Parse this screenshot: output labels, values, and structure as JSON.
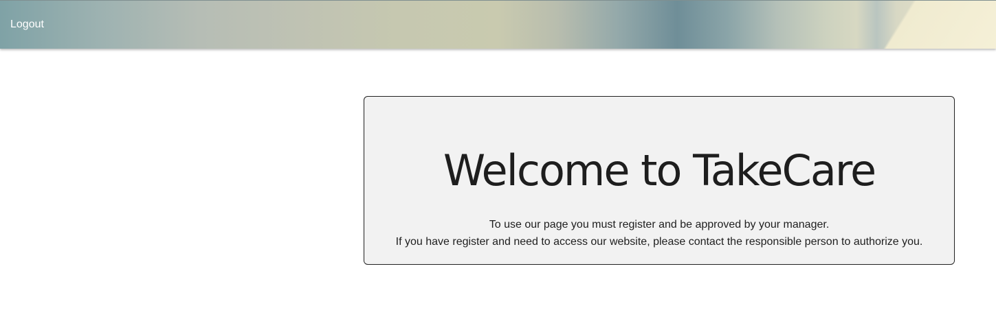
{
  "navbar": {
    "logout_label": "Logout"
  },
  "welcome": {
    "title": "Welcome to TakeCare",
    "line1": "To use our page you must register and be approved by your manager.",
    "line2": "If you have register and need to access our website, please contact the responsible person to authorize you."
  }
}
